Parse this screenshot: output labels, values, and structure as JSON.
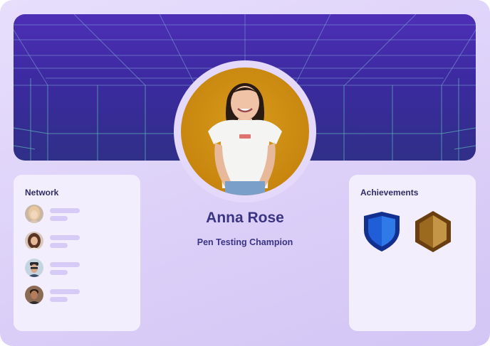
{
  "profile": {
    "name": "Anna Rose",
    "role": "Pen Testing Champion",
    "photo_icon": "user-photo"
  },
  "network": {
    "title": "Network",
    "contacts": [
      {
        "icon": "contact-avatar-1"
      },
      {
        "icon": "contact-avatar-2"
      },
      {
        "icon": "contact-avatar-3"
      },
      {
        "icon": "contact-avatar-4"
      }
    ]
  },
  "achievements": {
    "title": "Achievements",
    "badges": [
      {
        "icon": "blue-shield-badge-icon",
        "color": "#1f5ed6"
      },
      {
        "icon": "bronze-hexagon-badge-icon",
        "color": "#9c6a1e"
      }
    ]
  },
  "colors": {
    "accent": "#3a3483",
    "banner": "#3f2ba6",
    "grid": "#6fb0c4"
  }
}
